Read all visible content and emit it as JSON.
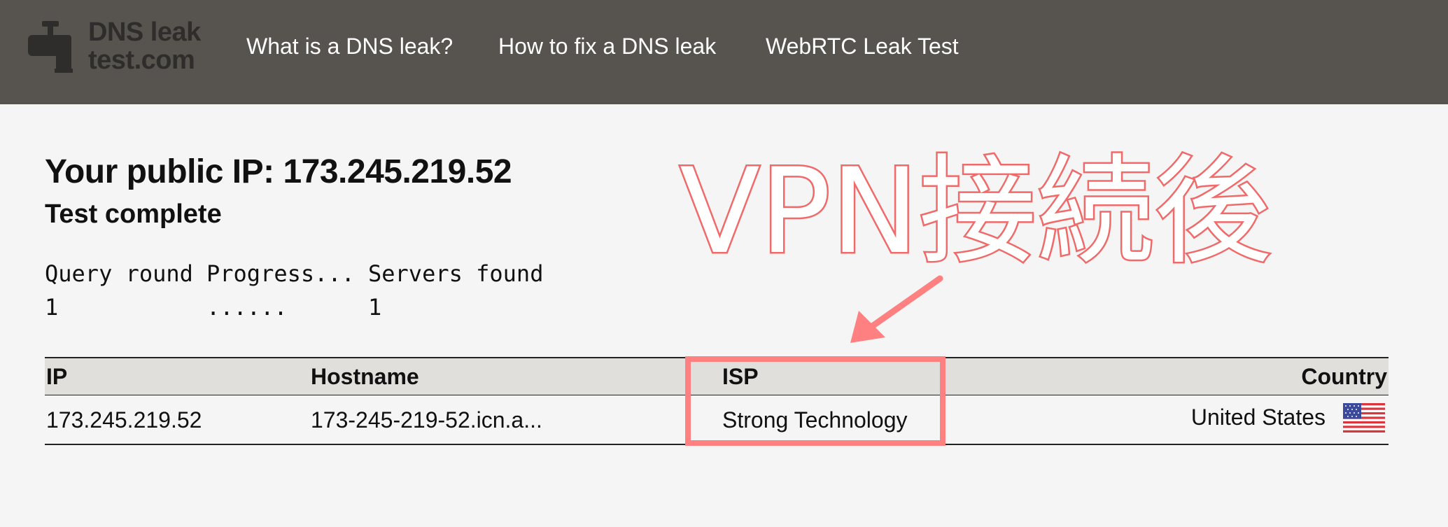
{
  "header": {
    "logo_text": "DNS leak\ntest.com",
    "nav": [
      {
        "label": "What is a DNS leak?"
      },
      {
        "label": "How to fix a DNS leak"
      },
      {
        "label": "WebRTC Leak Test"
      }
    ]
  },
  "main": {
    "public_ip": "Your public IP: 173.245.219.52",
    "status": "Test complete",
    "query_table": {
      "headers": [
        "Query round",
        "Progress...",
        "Servers found"
      ],
      "row": [
        "1",
        "......",
        "1"
      ]
    },
    "results": {
      "headers": [
        "IP",
        "Hostname",
        "ISP",
        "Country"
      ],
      "rows": [
        [
          "173.245.219.52",
          "173-245-219-52.icn.a...",
          "Strong Technology",
          "United States"
        ]
      ]
    }
  },
  "annotation": {
    "text": "VPN接続後",
    "color": "#ff8080"
  },
  "colors": {
    "header_bg": "#57534f",
    "page_bg": "#f5f5f5",
    "table_header_bg": "#e0dfdb",
    "annotation": "#ff8080"
  },
  "icons": {
    "logo": "faucet-icon",
    "flag": "us-flag-icon"
  }
}
